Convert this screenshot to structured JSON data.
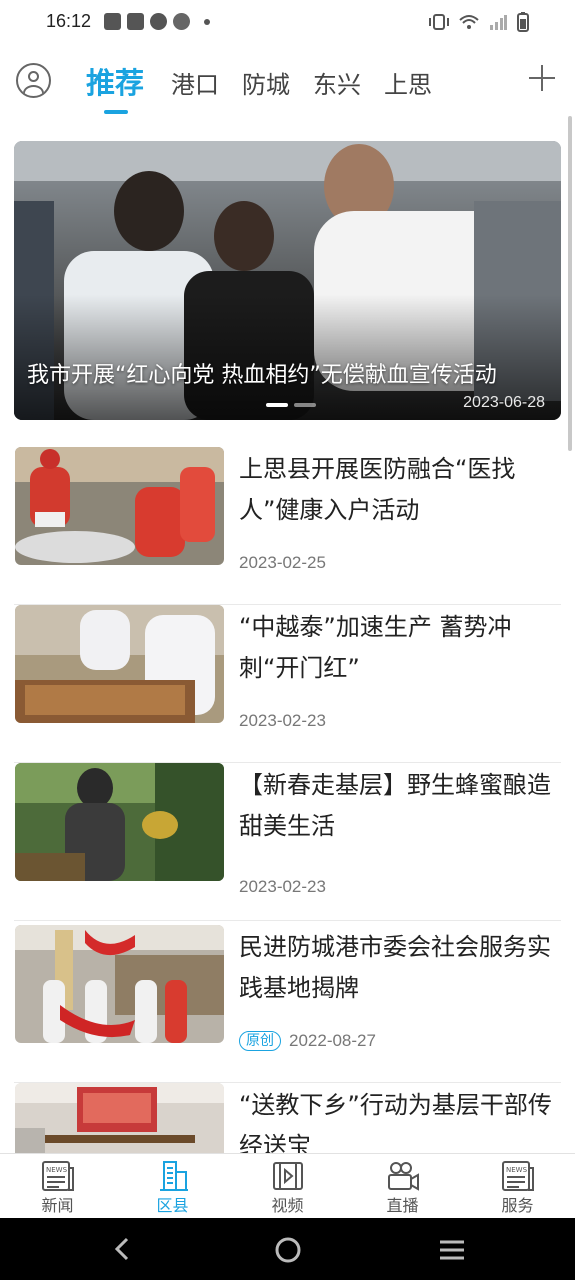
{
  "status_bar": {
    "time": "16:12",
    "left_icons": [
      "bag-icon",
      "bag-icon",
      "check-circle-icon",
      "shield-icon",
      "dot-icon"
    ],
    "right_icons": [
      "vibrate-icon",
      "wifi-icon",
      "signal-icon",
      "battery-icon"
    ]
  },
  "topnav": {
    "tabs": [
      {
        "label": "推荐",
        "active": true
      },
      {
        "label": "港口",
        "active": false
      },
      {
        "label": "防城",
        "active": false
      },
      {
        "label": "东兴",
        "active": false
      },
      {
        "label": "上思",
        "active": false
      }
    ],
    "avatar_icon": "user-circle-icon",
    "add_icon": "plus-icon",
    "accent_color": "#1aa3e0"
  },
  "hero": {
    "title": "我市开展“红心向党 热血相约”无偿献血宣传活动",
    "date": "2023-06-28",
    "slide_count": 2,
    "active_slide": 1
  },
  "news": [
    {
      "title": "上思县开展医防融合“医找人”健康入户活动",
      "date": "2023-02-25",
      "tag": ""
    },
    {
      "title": "“中越泰”加速生产 蓄势冲刺“开门红”",
      "date": "2023-02-23",
      "tag": ""
    },
    {
      "title": "【新春走基层】野生蜂蜜酿造甜美生活",
      "date": "2023-02-23",
      "tag": ""
    },
    {
      "title": "民进防城港市委会社会服务实践基地揭牌",
      "date": "2022-08-27",
      "tag": "原创"
    },
    {
      "title": "“送教下乡”行动为基层干部传经送宝",
      "date": "",
      "tag": ""
    }
  ],
  "bottom_tabs": [
    {
      "label": "新闻",
      "icon": "newspaper-icon",
      "active": false
    },
    {
      "label": "区县",
      "icon": "city-icon",
      "active": true
    },
    {
      "label": "视频",
      "icon": "video-icon",
      "active": false
    },
    {
      "label": "直播",
      "icon": "live-camera-icon",
      "active": false
    },
    {
      "label": "服务",
      "icon": "service-news-icon",
      "active": false
    }
  ],
  "system_nav": [
    "back-icon",
    "home-icon",
    "menu-icon"
  ]
}
